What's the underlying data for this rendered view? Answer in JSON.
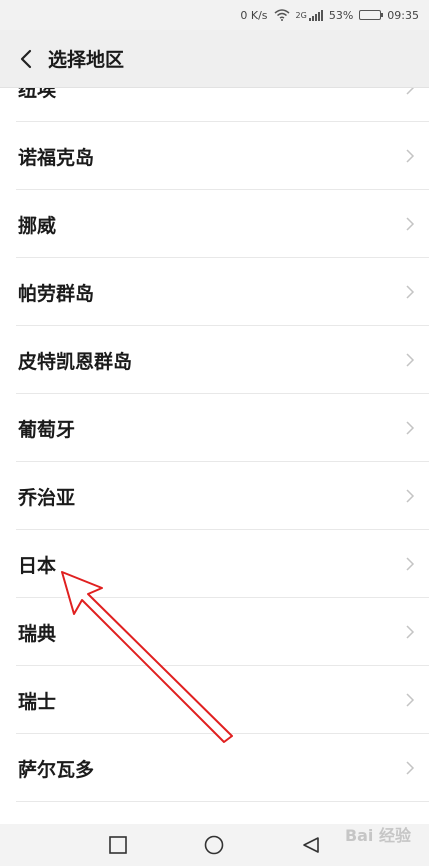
{
  "status_bar": {
    "speed": "0 K/s",
    "network": "2G",
    "battery": "53%",
    "battery_level": 0.53,
    "time": "09:35"
  },
  "header": {
    "back_icon": "chevron-left-icon",
    "title": "选择地区"
  },
  "regions": [
    {
      "label": "纽埃"
    },
    {
      "label": "诺福克岛"
    },
    {
      "label": "挪威"
    },
    {
      "label": "帕劳群岛"
    },
    {
      "label": "皮特凯恩群岛"
    },
    {
      "label": "葡萄牙"
    },
    {
      "label": "乔治亚"
    },
    {
      "label": "日本"
    },
    {
      "label": "瑞典"
    },
    {
      "label": "瑞士"
    },
    {
      "label": "萨尔瓦多"
    }
  ],
  "nav_bar": {
    "recent_icon": "square-icon",
    "home_icon": "circle-icon",
    "back_icon": "triangle-back-icon"
  },
  "watermark": "Bai 经验",
  "annotation": {
    "color": "#e02020",
    "icon": "red-arrow-icon"
  }
}
